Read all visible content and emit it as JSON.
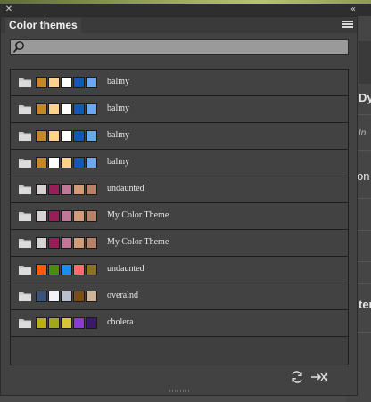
{
  "panel": {
    "title": "Color themes",
    "search_placeholder": ""
  },
  "icons": {
    "close": "close-icon",
    "collapse": "collapse-arrows-icon",
    "menu": "panel-menu-icon",
    "search": "magnifier-icon",
    "folder": "folder-icon",
    "refresh": "refresh-icon",
    "import": "import-shuffle-icon"
  },
  "themes": [
    {
      "name": "balmy",
      "colors": [
        "#c8862a",
        "#fdd38a",
        "#ffffff",
        "#1455b8",
        "#6aa9ef"
      ]
    },
    {
      "name": "balmy",
      "colors": [
        "#c8862a",
        "#fdd38a",
        "#ffffff",
        "#1455b8",
        "#6aa9ef"
      ]
    },
    {
      "name": "balmy",
      "colors": [
        "#c8862a",
        "#fdd38a",
        "#ffffff",
        "#1455b8",
        "#6aa9ef"
      ]
    },
    {
      "name": "balmy",
      "colors": [
        "#c8862a",
        "#ffffff",
        "#fdd38a",
        "#1455b8",
        "#6aa9ef"
      ]
    },
    {
      "name": "undaunted",
      "colors": [
        "#d7d3d3",
        "#9a1d5a",
        "#c07899",
        "#d49b78",
        "#b7826a"
      ]
    },
    {
      "name": "My Color Theme",
      "colors": [
        "#d7d3d3",
        "#9a1d5a",
        "#c07899",
        "#d49b78",
        "#b7826a"
      ]
    },
    {
      "name": "My Color Theme",
      "colors": [
        "#d7d3d3",
        "#9a1d5a",
        "#c07899",
        "#d49b78",
        "#b7826a"
      ]
    },
    {
      "name": "undaunted",
      "colors": [
        "#ff5a00",
        "#4c8a12",
        "#1a8ee8",
        "#ff6a6a",
        "#8a7320"
      ]
    },
    {
      "name": "overalnd",
      "colors": [
        "#3a5378",
        "#f0f2f7",
        "#b8c0ce",
        "#7a4e14",
        "#cdb59a"
      ]
    },
    {
      "name": "cholera",
      "colors": [
        "#b9b017",
        "#a2a61a",
        "#d6c53a",
        "#8a3ad6",
        "#3a1a6a"
      ]
    }
  ],
  "background_panel": {
    "labels": [
      "Dy",
      "In",
      "on a",
      "ter"
    ]
  }
}
